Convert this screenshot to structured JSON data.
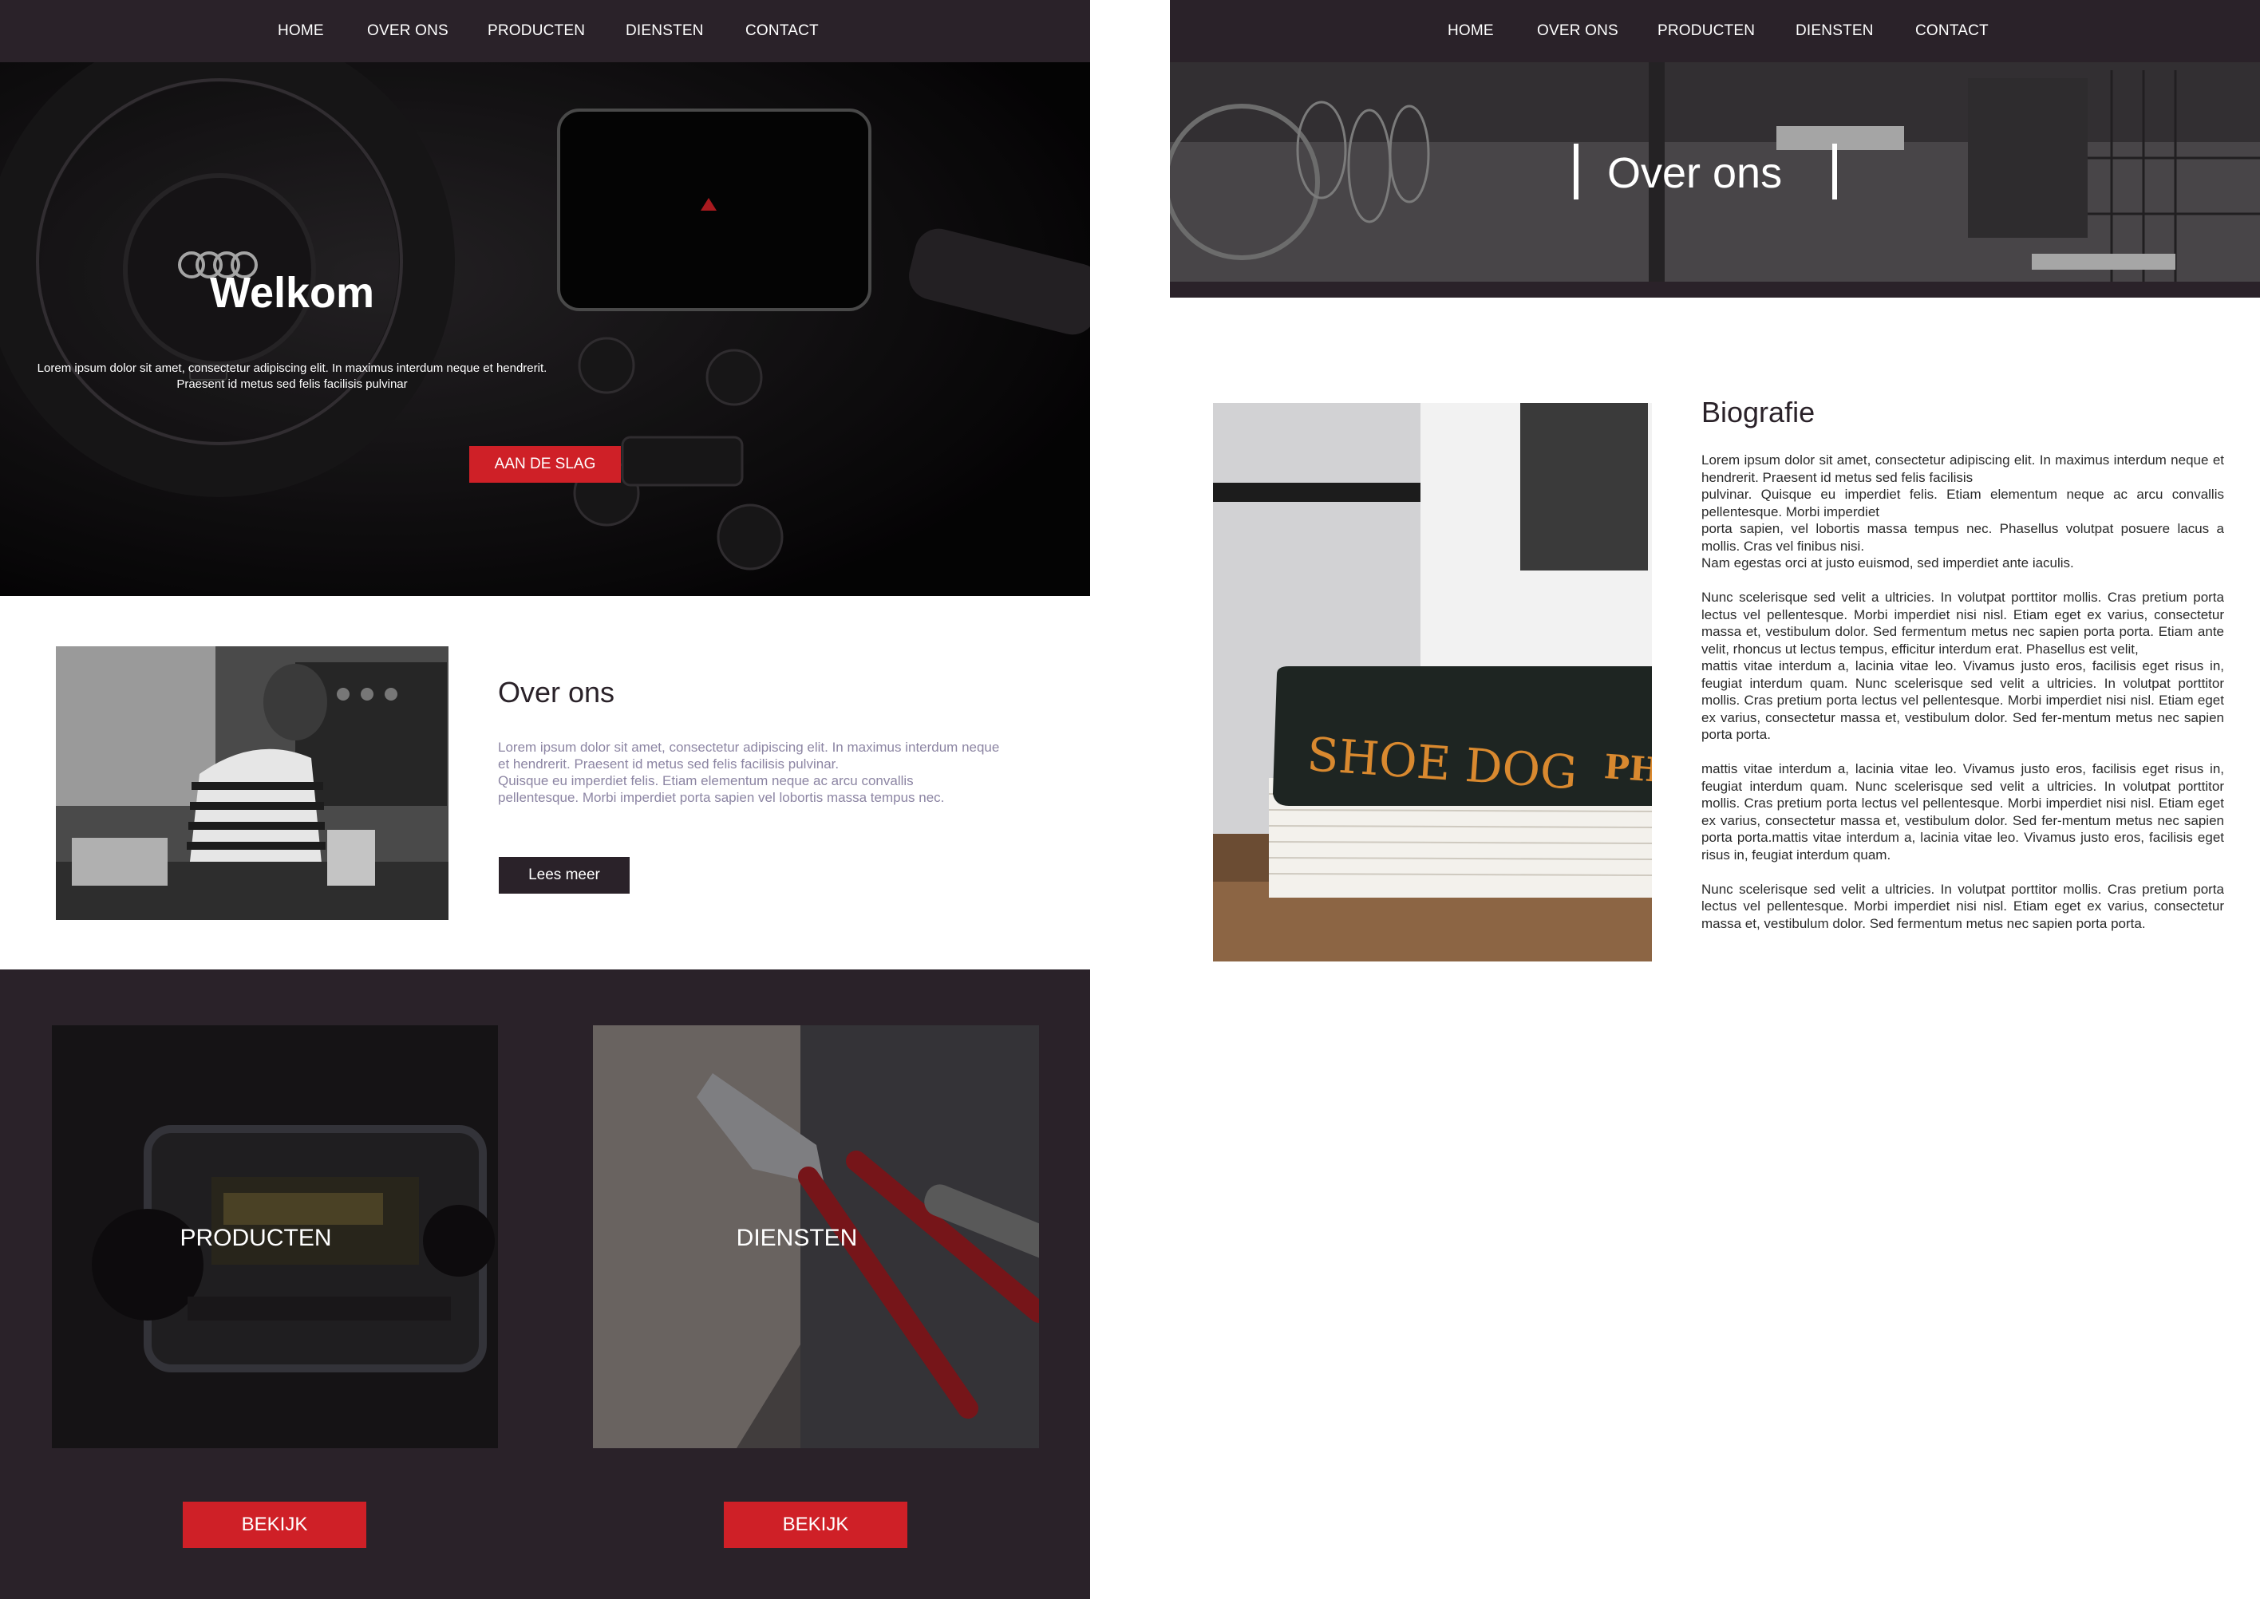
{
  "colors": {
    "dark": "#2a2229",
    "accent": "#cf2027",
    "white": "#ffffff",
    "muted": "#8c85a3"
  },
  "nav": {
    "home": "HOME",
    "over_ons": "OVER ONS",
    "producten": "PRODUCTEN",
    "diensten": "DIENSTEN",
    "contact": "CONTACT"
  },
  "home": {
    "hero": {
      "title": "Welkom",
      "text_line1": "Lorem ipsum dolor sit amet, consectetur adipiscing elit. In maximus interdum neque et hendrerit.",
      "text_line2": "Praesent id metus sed felis facilisis pulvinar",
      "cta": "AAN DE SLAG",
      "image": "car-dashboard-photo"
    },
    "about": {
      "heading": "Over ons",
      "text_line1": "Lorem ipsum dolor sit amet, consectetur adipiscing elit. In maximus interdum neque",
      "text_line2": "et hendrerit. Praesent id metus sed felis facilisis pulvinar.",
      "text_line3": "Quisque eu imperdiet felis. Etiam elementum neque ac arcu convallis",
      "text_line4": "pellentesque. Morbi imperdiet porta sapien  vel lobortis massa tempus nec.",
      "button": "Lees meer",
      "image": "barista-photo"
    },
    "cards": [
      {
        "label": "PRODUCTEN",
        "button": "BEKIJK",
        "image": "car-radio-photo"
      },
      {
        "label": "DIENSTEN",
        "button": "BEKIJK",
        "image": "pliers-photo"
      }
    ]
  },
  "about_page": {
    "banner_title": "Over ons",
    "bio_heading": "Biografie",
    "image": "shoe-dog-book-photo",
    "book_title": "SHOE DOG",
    "book_author_fragment": "PHI",
    "bio_paragraphs": [
      "Lorem ipsum dolor sit amet, consectetur adipiscing elit. In maximus interdum neque et hendrerit. Praesent id metus sed felis facilisis\npulvinar. Quisque eu imperdiet felis. Etiam elementum neque ac arcu convallis pellentesque. Morbi imperdiet\nporta sapien, vel lobortis massa tempus nec. Phasellus volutpat posuere lacus a mollis. Cras vel finibus nisi.\nNam egestas orci at justo euismod, sed imperdiet ante iaculis.",
      "Nunc scelerisque sed velit a ultricies. In volutpat porttitor mollis. Cras pretium porta lectus vel pellentesque. Morbi imperdiet nisi nisl. Etiam eget ex varius, consectetur massa et, vestibulum dolor. Sed fermentum metus nec sapien porta porta. Etiam ante velit, rhoncus ut lectus tempus, efficitur interdum erat. Phasellus est velit,\nmattis vitae interdum a, lacinia vitae leo. Vivamus justo eros, facilisis eget risus in, feugiat interdum quam. Nunc scelerisque sed velit a ultricies. In volutpat porttitor mollis. Cras pretium porta lectus vel pellentesque. Morbi imperdiet nisi nisl. Etiam eget ex varius, consectetur massa et, vestibulum dolor. Sed fer-mentum metus nec sapien porta porta.",
      "mattis vitae interdum a, lacinia vitae leo. Vivamus justo eros, facilisis eget risus in, feugiat interdum quam. Nunc scelerisque sed velit a ultricies. In volutpat porttitor mollis. Cras pretium porta lectus vel pellentesque. Morbi imperdiet nisi nisl. Etiam eget ex varius, consectetur massa et, vestibulum dolor. Sed fer-mentum metus nec sapien porta porta.mattis vitae interdum a, lacinia vitae leo. Vivamus justo eros, facilisis eget risus in, feugiat interdum quam.",
      "Nunc scelerisque sed velit a ultricies. In volutpat porttitor mollis. Cras pretium porta lectus vel pellentesque. Morbi imperdiet nisi nisl. Etiam eget ex varius, consectetur massa et, vestibulum dolor. Sed fermentum metus nec sapien porta porta."
    ]
  }
}
